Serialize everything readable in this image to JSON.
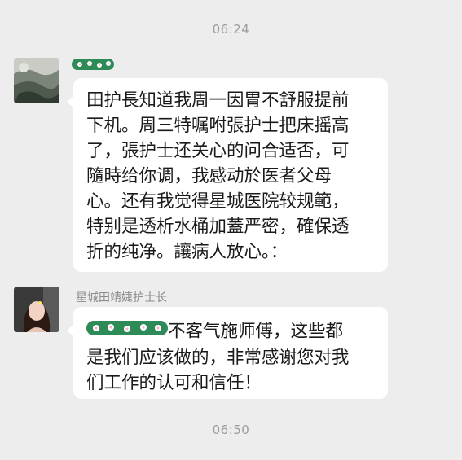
{
  "chat": {
    "timestamps": [
      "06:24",
      "06:50"
    ],
    "messages": [
      {
        "sender_name": "",
        "lines": [
          "田护長知道我周一因胃不舒服提前",
          "下机。周三特嘱咐張护士把床摇高",
          "了，張护士还关心的问合适否，可",
          "隨時给你调，我感动於医者父母",
          "心。还有我觉得星城医院较规範，",
          "特别是透析水桶加蓋严密，確保透",
          "折的纯净。讓病人放心。："
        ]
      },
      {
        "sender_name": "星城田靖婕护士长",
        "lines": [
          "不客气施师傅，这些都",
          "是我们应该做的，非常感谢您对我",
          "们工作的认可和信任！"
        ]
      }
    ]
  },
  "colors": {
    "background": "#ededed",
    "bubble": "#ffffff",
    "censor_sticker": "#2e8b57"
  },
  "icons": {
    "censor_sticker": "flower-sticker-icon"
  }
}
